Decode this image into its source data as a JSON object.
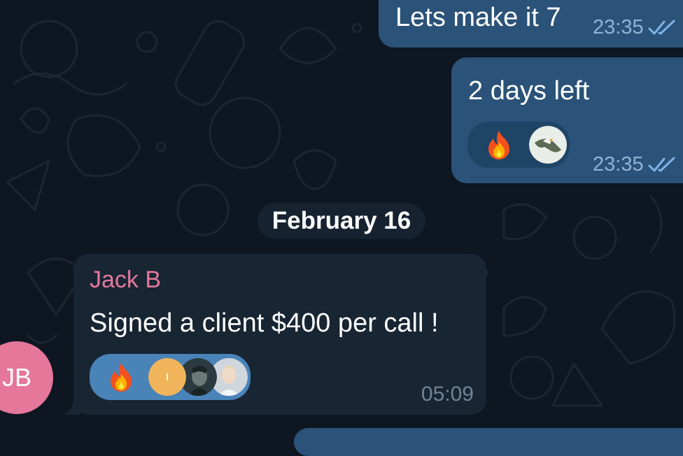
{
  "messages_out": [
    {
      "text": "Lets make it 7",
      "time": "23:35"
    },
    {
      "text": "2 days left",
      "time": "23:35",
      "reactions": [
        "fire-emoji",
        "eagle-avatar"
      ]
    }
  ],
  "date_separator": "February 16",
  "message_in": {
    "sender": "Jack B",
    "text": "Signed a client $400 per call !",
    "time": "05:09",
    "reactions": [
      "fire-emoji",
      "yellow-avatar",
      "dark-avatar",
      "portrait-avatar"
    ]
  },
  "avatar_initials": "JB",
  "colors": {
    "background": "#0e1621",
    "outgoing": "#2b5278",
    "incoming": "#182533",
    "sender_name": "#e4779a",
    "reaction_active": "#4a83b8",
    "tick": "#7fb2e6"
  }
}
